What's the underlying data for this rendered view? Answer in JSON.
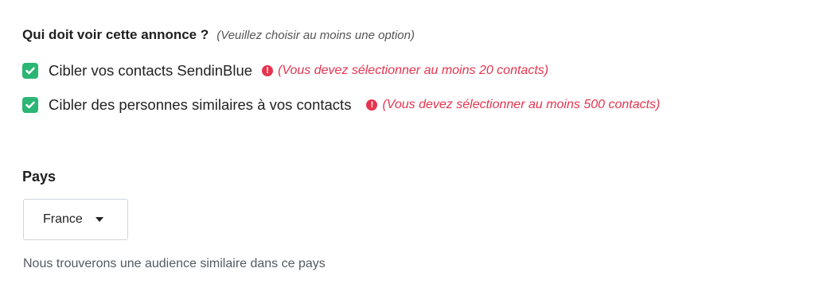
{
  "question": {
    "title": "Qui doit voir cette annonce ?",
    "hint": "(Veuillez choisir au moins une option)"
  },
  "options": [
    {
      "label": "Cibler vos contacts SendinBlue",
      "checked": true,
      "warning": "(Vous devez sélectionner au moins 20 contacts)"
    },
    {
      "label": "Cibler des personnes similaires à vos contacts",
      "checked": true,
      "warning": "(Vous devez sélectionner au moins 500 contacts)"
    }
  ],
  "country": {
    "label": "Pays",
    "selected": "France",
    "help": "Nous trouverons une audience similaire dans ce pays"
  },
  "colors": {
    "checkbox": "#2bb673",
    "warning": "#e6344f",
    "border": "#cfd5dc"
  },
  "icons": {
    "checkbox": "checkmark-icon",
    "warning": "exclamation-circle-icon",
    "dropdown": "caret-down-icon"
  }
}
